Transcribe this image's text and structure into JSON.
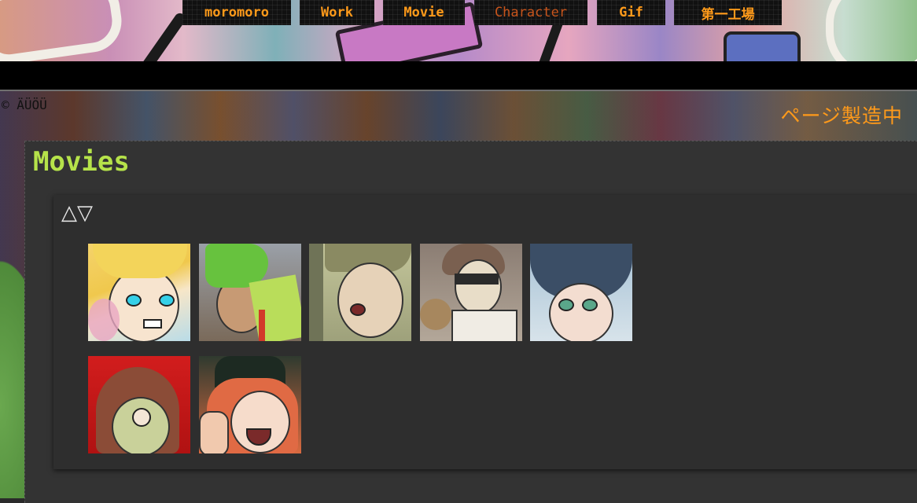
{
  "nav": {
    "items": [
      {
        "label": "moromoro"
      },
      {
        "label": "Work"
      },
      {
        "label": "Movie"
      },
      {
        "label": "Character"
      },
      {
        "label": "Gif"
      },
      {
        "label": "第一工場"
      }
    ],
    "active_index": 3
  },
  "header": {
    "copyright": "© ÄÜÖÜ",
    "wip": "ページ製造中"
  },
  "main": {
    "title": "Movies",
    "sort_icon": "△▽",
    "thumbnails": [
      {
        "name": "blonde-boy-thumbnail"
      },
      {
        "name": "green-hair-thumbnail"
      },
      {
        "name": "cap-boy-thumbnail"
      },
      {
        "name": "bandaged-thumbnail"
      },
      {
        "name": "dark-hair-thumbnail"
      },
      {
        "name": "red-hood-thumbnail"
      },
      {
        "name": "cat-hat-thumbnail"
      }
    ]
  },
  "colors": {
    "nav_text": "#ff9a1a",
    "nav_active": "#c8551c",
    "title": "#b6e34a",
    "panel": "#333333"
  }
}
